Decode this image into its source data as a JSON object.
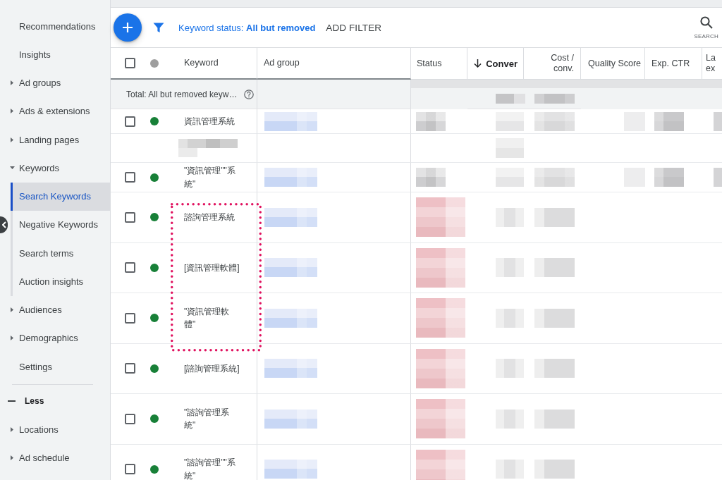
{
  "sidebar": {
    "items": [
      {
        "label": "Recommendations",
        "kind": "link",
        "selected": false
      },
      {
        "label": "Insights",
        "kind": "link",
        "selected": false
      },
      {
        "label": "Ad groups",
        "kind": "group",
        "expanded": false,
        "selected": false
      },
      {
        "label": "Ads & extensions",
        "kind": "group",
        "expanded": false,
        "selected": false
      },
      {
        "label": "Landing pages",
        "kind": "group",
        "expanded": false,
        "selected": false
      },
      {
        "label": "Keywords",
        "kind": "group",
        "expanded": true,
        "selected": false,
        "children": [
          {
            "label": "Search Keywords",
            "selected": true
          },
          {
            "label": "Negative Keywords",
            "selected": false
          },
          {
            "label": "Search terms",
            "selected": false
          },
          {
            "label": "Auction insights",
            "selected": false
          }
        ]
      },
      {
        "label": "Audiences",
        "kind": "group",
        "expanded": false,
        "selected": false
      },
      {
        "label": "Demographics",
        "kind": "group",
        "expanded": false,
        "selected": false
      },
      {
        "label": "Settings",
        "kind": "link",
        "selected": false
      },
      {
        "label": "Less",
        "kind": "toggle",
        "selected": false
      },
      {
        "label": "Locations",
        "kind": "group",
        "expanded": false,
        "selected": false
      },
      {
        "label": "Ad schedule",
        "kind": "group",
        "expanded": false,
        "selected": false
      }
    ]
  },
  "toolbar": {
    "filter": "Keyword status: **All but removed**",
    "add_filter": "ADD FILTER",
    "search_label": "SEARCH"
  },
  "table": {
    "select_all": {
      "checked": false
    },
    "columns": [
      {
        "label": "Keyword",
        "kind": "text",
        "sorted": false
      },
      {
        "label": "Ad group",
        "kind": "text",
        "sorted": false
      },
      {
        "label": "Status",
        "kind": "text",
        "sorted": false
      },
      {
        "label": "Conver",
        "kind": "number",
        "sorted": true
      },
      {
        "label": "Cost / conv.",
        "kind": "number",
        "sorted": false
      },
      {
        "label": "Quality Score",
        "kind": "text",
        "sorted": false
      },
      {
        "label": "Exp. CTR",
        "kind": "text",
        "sorted": false
      },
      {
        "label": "La ex",
        "kind": "text",
        "sorted": false
      }
    ],
    "total": {
      "label": "Total: All but removed keyw…"
    },
    "rows": [
      {
        "kind": "plain",
        "checked": false,
        "enabled": true,
        "keyword": "資訊管理系統",
        "highlighted": false
      },
      {
        "kind": "detail",
        "highlighted": false
      },
      {
        "kind": "plain",
        "checked": false,
        "enabled": true,
        "keyword": "\"資訊管理\"\"系統\"",
        "highlighted": false
      },
      {
        "kind": "warning",
        "checked": false,
        "enabled": true,
        "keyword": "諮詢管理系統",
        "highlighted": true
      },
      {
        "kind": "warning",
        "checked": false,
        "enabled": true,
        "keyword": "[資訊管理軟體]",
        "highlighted": true
      },
      {
        "kind": "warning",
        "checked": false,
        "enabled": true,
        "keyword": "\"資訊管理軟體\"",
        "highlighted": true
      },
      {
        "kind": "warning",
        "checked": false,
        "enabled": true,
        "keyword": "[諮詢管理系統]",
        "highlighted": false
      },
      {
        "kind": "warning",
        "checked": false,
        "enabled": true,
        "keyword": "\"諮詢管理系統\"",
        "highlighted": false
      },
      {
        "kind": "warning",
        "checked": false,
        "enabled": true,
        "keyword": "\"諮詢管理\"\"系統\"",
        "highlighted": false
      }
    ]
  }
}
